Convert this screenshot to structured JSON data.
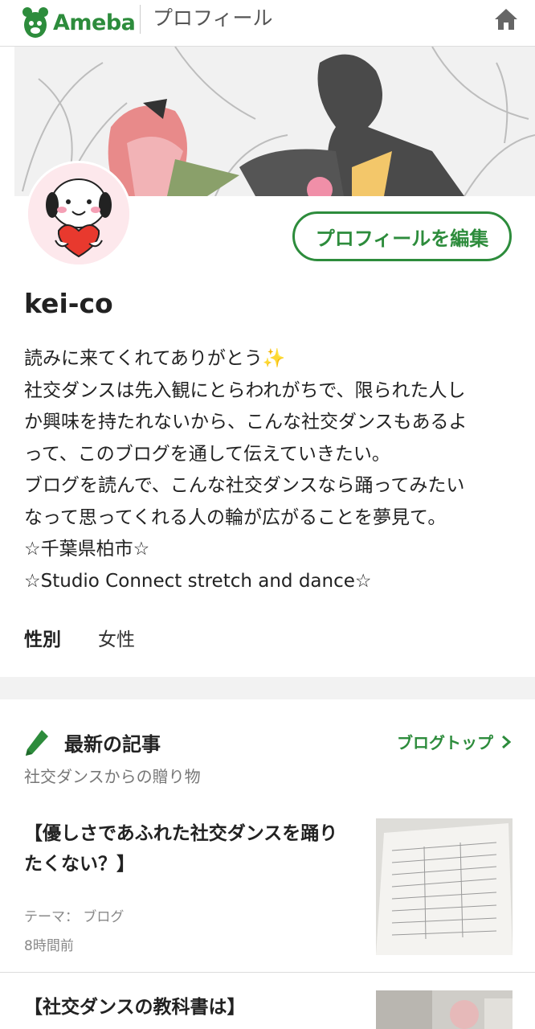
{
  "header": {
    "logo_text": "Ameba",
    "title": "プロフィール"
  },
  "profile": {
    "edit_button": "プロフィールを編集",
    "username": "kei-co",
    "bio_lines": [
      "読みに来てくれてありがとう✨",
      "社交ダンスは先入観にとらわれがちで、限られた人し",
      "か興味を持たれないから、こんな社交ダンスもあるよ",
      "って、このブログを通して伝えていきたい。",
      "ブログを読んで、こんな社交ダンスなら踊ってみたい",
      "なって思ってくれる人の輪が広がることを夢見て。",
      "☆千葉県柏市☆",
      "☆Studio Connect stretch and dance☆"
    ],
    "gender_label": "性別",
    "gender_value": "女性"
  },
  "posts": {
    "title": "最新の記事",
    "blog_top": "ブログトップ",
    "blog_name": "社交ダンスからの贈り物",
    "items": [
      {
        "title": "【優しさであふれた社交ダンスを踊りたくない？】",
        "theme": "テーマ： ブログ",
        "time": "8時間前"
      },
      {
        "title": "【社交ダンスの教科書は】"
      }
    ]
  },
  "colors": {
    "brand_green": "#2d8c3c"
  }
}
